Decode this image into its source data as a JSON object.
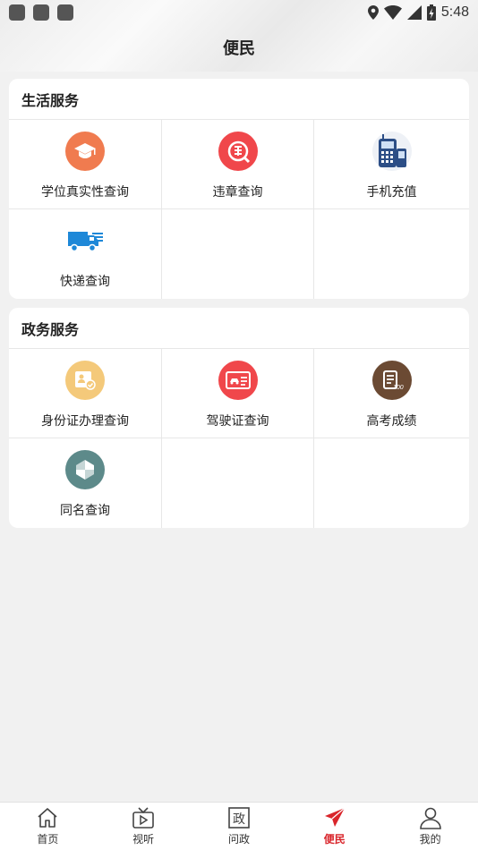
{
  "status_bar": {
    "time": "5:48"
  },
  "header": {
    "title": "便民"
  },
  "sections": [
    {
      "title": "生活服务",
      "items": [
        {
          "label": "学位真实性查询",
          "icon": "graduation-cap-icon",
          "color": "#f07b4f"
        },
        {
          "label": "违章查询",
          "icon": "traffic-violation-icon",
          "color": "#f0474b"
        },
        {
          "label": "手机充值",
          "icon": "mobile-phone-icon",
          "color": "#2c4e86"
        },
        {
          "label": "快递查询",
          "icon": "delivery-truck-icon",
          "color": "#1e88d8"
        }
      ]
    },
    {
      "title": "政务服务",
      "items": [
        {
          "label": "身份证办理查询",
          "icon": "id-card-icon",
          "color": "#f4c97a"
        },
        {
          "label": "驾驶证查询",
          "icon": "driver-license-icon",
          "color": "#f0474b"
        },
        {
          "label": "高考成绩",
          "icon": "exam-score-icon",
          "color": "#6b4a33"
        },
        {
          "label": "同名查询",
          "icon": "same-name-icon",
          "color": "#5d8a8a"
        }
      ]
    }
  ],
  "bottom_nav": [
    {
      "label": "首页",
      "icon": "home-icon",
      "active": false
    },
    {
      "label": "视听",
      "icon": "tv-icon",
      "active": false
    },
    {
      "label": "问政",
      "icon": "wenzheng-icon",
      "active": false,
      "icon_text": "政"
    },
    {
      "label": "便民",
      "icon": "paper-plane-icon",
      "active": true
    },
    {
      "label": "我的",
      "icon": "user-icon",
      "active": false
    }
  ],
  "colors": {
    "accent": "#d9252b"
  }
}
